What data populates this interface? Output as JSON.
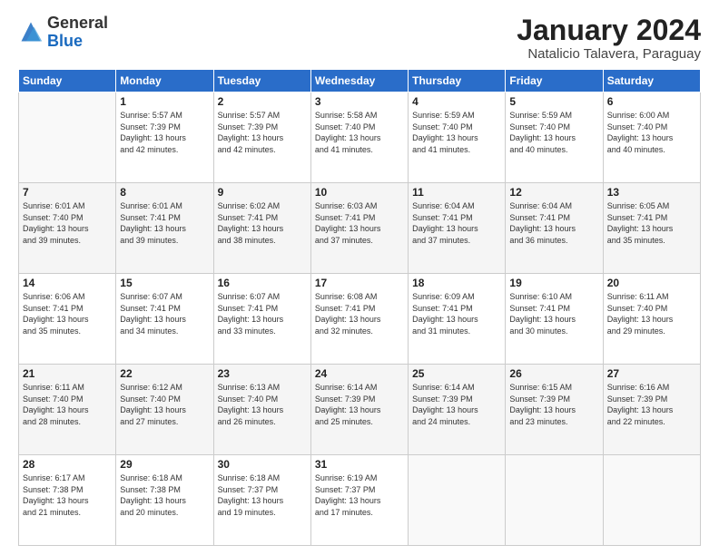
{
  "logo": {
    "general": "General",
    "blue": "Blue"
  },
  "header": {
    "month": "January 2024",
    "location": "Natalicio Talavera, Paraguay"
  },
  "weekdays": [
    "Sunday",
    "Monday",
    "Tuesday",
    "Wednesday",
    "Thursday",
    "Friday",
    "Saturday"
  ],
  "weeks": [
    [
      {
        "day": "",
        "info": ""
      },
      {
        "day": "1",
        "info": "Sunrise: 5:57 AM\nSunset: 7:39 PM\nDaylight: 13 hours\nand 42 minutes."
      },
      {
        "day": "2",
        "info": "Sunrise: 5:57 AM\nSunset: 7:39 PM\nDaylight: 13 hours\nand 42 minutes."
      },
      {
        "day": "3",
        "info": "Sunrise: 5:58 AM\nSunset: 7:40 PM\nDaylight: 13 hours\nand 41 minutes."
      },
      {
        "day": "4",
        "info": "Sunrise: 5:59 AM\nSunset: 7:40 PM\nDaylight: 13 hours\nand 41 minutes."
      },
      {
        "day": "5",
        "info": "Sunrise: 5:59 AM\nSunset: 7:40 PM\nDaylight: 13 hours\nand 40 minutes."
      },
      {
        "day": "6",
        "info": "Sunrise: 6:00 AM\nSunset: 7:40 PM\nDaylight: 13 hours\nand 40 minutes."
      }
    ],
    [
      {
        "day": "7",
        "info": "Sunrise: 6:01 AM\nSunset: 7:40 PM\nDaylight: 13 hours\nand 39 minutes."
      },
      {
        "day": "8",
        "info": "Sunrise: 6:01 AM\nSunset: 7:41 PM\nDaylight: 13 hours\nand 39 minutes."
      },
      {
        "day": "9",
        "info": "Sunrise: 6:02 AM\nSunset: 7:41 PM\nDaylight: 13 hours\nand 38 minutes."
      },
      {
        "day": "10",
        "info": "Sunrise: 6:03 AM\nSunset: 7:41 PM\nDaylight: 13 hours\nand 37 minutes."
      },
      {
        "day": "11",
        "info": "Sunrise: 6:04 AM\nSunset: 7:41 PM\nDaylight: 13 hours\nand 37 minutes."
      },
      {
        "day": "12",
        "info": "Sunrise: 6:04 AM\nSunset: 7:41 PM\nDaylight: 13 hours\nand 36 minutes."
      },
      {
        "day": "13",
        "info": "Sunrise: 6:05 AM\nSunset: 7:41 PM\nDaylight: 13 hours\nand 35 minutes."
      }
    ],
    [
      {
        "day": "14",
        "info": "Sunrise: 6:06 AM\nSunset: 7:41 PM\nDaylight: 13 hours\nand 35 minutes."
      },
      {
        "day": "15",
        "info": "Sunrise: 6:07 AM\nSunset: 7:41 PM\nDaylight: 13 hours\nand 34 minutes."
      },
      {
        "day": "16",
        "info": "Sunrise: 6:07 AM\nSunset: 7:41 PM\nDaylight: 13 hours\nand 33 minutes."
      },
      {
        "day": "17",
        "info": "Sunrise: 6:08 AM\nSunset: 7:41 PM\nDaylight: 13 hours\nand 32 minutes."
      },
      {
        "day": "18",
        "info": "Sunrise: 6:09 AM\nSunset: 7:41 PM\nDaylight: 13 hours\nand 31 minutes."
      },
      {
        "day": "19",
        "info": "Sunrise: 6:10 AM\nSunset: 7:41 PM\nDaylight: 13 hours\nand 30 minutes."
      },
      {
        "day": "20",
        "info": "Sunrise: 6:11 AM\nSunset: 7:40 PM\nDaylight: 13 hours\nand 29 minutes."
      }
    ],
    [
      {
        "day": "21",
        "info": "Sunrise: 6:11 AM\nSunset: 7:40 PM\nDaylight: 13 hours\nand 28 minutes."
      },
      {
        "day": "22",
        "info": "Sunrise: 6:12 AM\nSunset: 7:40 PM\nDaylight: 13 hours\nand 27 minutes."
      },
      {
        "day": "23",
        "info": "Sunrise: 6:13 AM\nSunset: 7:40 PM\nDaylight: 13 hours\nand 26 minutes."
      },
      {
        "day": "24",
        "info": "Sunrise: 6:14 AM\nSunset: 7:39 PM\nDaylight: 13 hours\nand 25 minutes."
      },
      {
        "day": "25",
        "info": "Sunrise: 6:14 AM\nSunset: 7:39 PM\nDaylight: 13 hours\nand 24 minutes."
      },
      {
        "day": "26",
        "info": "Sunrise: 6:15 AM\nSunset: 7:39 PM\nDaylight: 13 hours\nand 23 minutes."
      },
      {
        "day": "27",
        "info": "Sunrise: 6:16 AM\nSunset: 7:39 PM\nDaylight: 13 hours\nand 22 minutes."
      }
    ],
    [
      {
        "day": "28",
        "info": "Sunrise: 6:17 AM\nSunset: 7:38 PM\nDaylight: 13 hours\nand 21 minutes."
      },
      {
        "day": "29",
        "info": "Sunrise: 6:18 AM\nSunset: 7:38 PM\nDaylight: 13 hours\nand 20 minutes."
      },
      {
        "day": "30",
        "info": "Sunrise: 6:18 AM\nSunset: 7:37 PM\nDaylight: 13 hours\nand 19 minutes."
      },
      {
        "day": "31",
        "info": "Sunrise: 6:19 AM\nSunset: 7:37 PM\nDaylight: 13 hours\nand 17 minutes."
      },
      {
        "day": "",
        "info": ""
      },
      {
        "day": "",
        "info": ""
      },
      {
        "day": "",
        "info": ""
      }
    ]
  ]
}
